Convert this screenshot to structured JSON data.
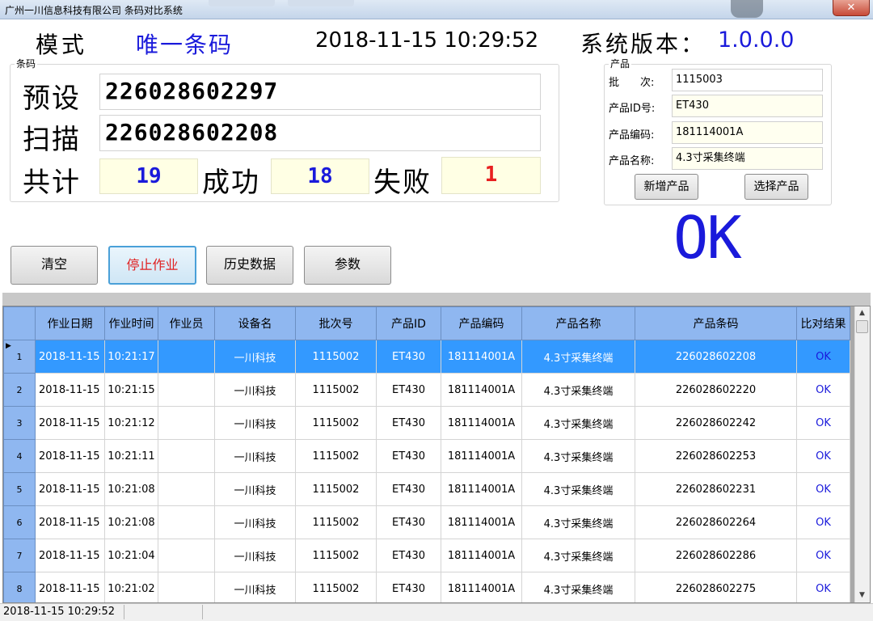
{
  "window": {
    "title": "广州一川信息科技有限公司 条码对比系统",
    "close_icon": "close-icon"
  },
  "header": {
    "mode_label": "模式",
    "mode_value": "唯一条码",
    "datetime": "2018-11-15 10:29:52",
    "version_label": "系统版本：",
    "version_value": "1.0.0.0"
  },
  "barcode": {
    "caption": "条码",
    "preset_label": "预设",
    "preset_value": "226028602297",
    "scan_label": "扫描",
    "scan_value": "226028602208",
    "total_label": "共计",
    "total_value": "19",
    "success_label": "成功",
    "success_value": "18",
    "fail_label": "失败",
    "fail_value": "1"
  },
  "product": {
    "caption": "产品",
    "batch_label": "批　　次:",
    "batch_value": "1115003",
    "id_label": "产品ID号:",
    "id_value": "ET430",
    "code_label": "产品编码:",
    "code_value": "181114001A",
    "name_label": "产品名称:",
    "name_value": "4.3寸采集终端",
    "add_button": "新增产品",
    "select_button": "选择产品"
  },
  "result_display": "OK",
  "actions": {
    "clear": "清空",
    "stop": "停止作业",
    "history": "历史数据",
    "params": "参数"
  },
  "table": {
    "columns": [
      "作业日期",
      "作业时间",
      "作业员",
      "设备名",
      "批次号",
      "产品ID",
      "产品编码",
      "产品名称",
      "产品条码",
      "比对结果"
    ],
    "rows": [
      {
        "no": "1",
        "cells": [
          "2018-11-15",
          "10:21:17",
          "",
          "一川科技",
          "1115002",
          "ET430",
          "181114001A",
          "4.3寸采集终端",
          "226028602208",
          "OK"
        ]
      },
      {
        "no": "2",
        "cells": [
          "2018-11-15",
          "10:21:15",
          "",
          "一川科技",
          "1115002",
          "ET430",
          "181114001A",
          "4.3寸采集终端",
          "226028602220",
          "OK"
        ]
      },
      {
        "no": "3",
        "cells": [
          "2018-11-15",
          "10:21:12",
          "",
          "一川科技",
          "1115002",
          "ET430",
          "181114001A",
          "4.3寸采集终端",
          "226028602242",
          "OK"
        ]
      },
      {
        "no": "4",
        "cells": [
          "2018-11-15",
          "10:21:11",
          "",
          "一川科技",
          "1115002",
          "ET430",
          "181114001A",
          "4.3寸采集终端",
          "226028602253",
          "OK"
        ]
      },
      {
        "no": "5",
        "cells": [
          "2018-11-15",
          "10:21:08",
          "",
          "一川科技",
          "1115002",
          "ET430",
          "181114001A",
          "4.3寸采集终端",
          "226028602231",
          "OK"
        ]
      },
      {
        "no": "6",
        "cells": [
          "2018-11-15",
          "10:21:08",
          "",
          "一川科技",
          "1115002",
          "ET430",
          "181114001A",
          "4.3寸采集终端",
          "226028602264",
          "OK"
        ]
      },
      {
        "no": "7",
        "cells": [
          "2018-11-15",
          "10:21:04",
          "",
          "一川科技",
          "1115002",
          "ET430",
          "181114001A",
          "4.3寸采集终端",
          "226028602286",
          "OK"
        ]
      },
      {
        "no": "8",
        "cells": [
          "2018-11-15",
          "10:21:02",
          "",
          "一川科技",
          "1115002",
          "ET430",
          "181114001A",
          "4.3寸采集终端",
          "226028602275",
          "OK"
        ]
      }
    ],
    "selected_row": "1"
  },
  "status_bar": {
    "time": "2018-11-15 10:29:52"
  },
  "colors": {
    "accent_blue": "#1a1adb",
    "fail_red": "#e82020",
    "header_blue": "#8fb7f0",
    "selection_blue": "#3399ff"
  }
}
